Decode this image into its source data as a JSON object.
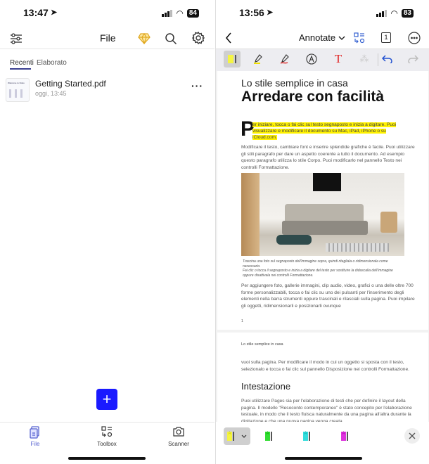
{
  "left": {
    "status": {
      "time": "13:47",
      "battery": "84"
    },
    "header": {
      "title": "File"
    },
    "tabs": [
      {
        "label": "Recenti",
        "active": true
      },
      {
        "label": "Elaborato",
        "active": false
      }
    ],
    "files": [
      {
        "name": "Getting Started.pdf",
        "date": "oggi, 13:45",
        "thumb_title": "Welcome to Dodo"
      }
    ],
    "fab": "+",
    "bottom_nav": [
      {
        "label": "File",
        "active": true
      },
      {
        "label": "Toolbox"
      },
      {
        "label": "Scanner"
      }
    ],
    "accent": "#1a1aff"
  },
  "right": {
    "status": {
      "time": "13:56",
      "battery": "83"
    },
    "header": {
      "mode": "Annotate",
      "page_count": "1"
    },
    "doc": {
      "kicker": "Lo stile semplice in casa",
      "title": "Arredare con facilità",
      "dropcap": "P",
      "lead": "er iniziare, tocca o fai clic sul testo segnaposto e inizia a digitare. Puoi visualizzare e modificare il documento su Mac, iPad, iPhone o su iCloud.com.",
      "p1": "Modificare il testo, cambiare font e inserire splendide grafiche è facile. Puoi utilizzare gli stili paragrafo per dare un aspetto coerente a tutto il documento. Ad esempio questo paragrafo utilizza lo stile Corpo. Puoi modificarlo nel pannello Testo nei controlli Formattazione.",
      "caption1": "Trascina una foto sul segnaposto dell'immagine sopra, quindi ritagliala o ridimensionala come necessario.",
      "caption2": "Fai clic o tocca il segnaposto e inizia a digitare del testo per sostituire la didascalia dell'immagine oppure disattivala nei controlli Formattazione.",
      "p2": "Per aggiungere foto, gallerie immagini, clip audio, video, grafici o una delle oltre 700 forme personalizzabili, tocca o fai clic su uno dei pulsanti per l'inserimento degli elementi nella barra strumenti oppure trascinali e rilasciali sulla pagina. Puoi impilare gli oggetti, ridimensionarli e posizionarli ovunque",
      "page_number": "1",
      "page2_header": "Lo stile semplice in casa",
      "p3": "vuoi sulla pagina. Per modificare il modo in cui un oggetto si sposta con il testo, selezionalo e tocca o fai clic sul pannello Disposizione nei controlli Formattazione.",
      "heading2": "Intestazione",
      "p4": "Puoi utilizzare Pages sia per l'elaborazione di testi che per definire il layout della pagina. Il modello \"Resoconto contemporaneo\" è stato concepito per l'elaborazione testuale, in modo che il testo fluisca naturalmente da una pagina all'altra durante la digitazione e che una nuova pagina venga creata"
    },
    "highlight_colors": [
      "#f5f542",
      "#33dd33",
      "#33dddd",
      "#dd33dd"
    ],
    "highlight_letter": "A"
  }
}
